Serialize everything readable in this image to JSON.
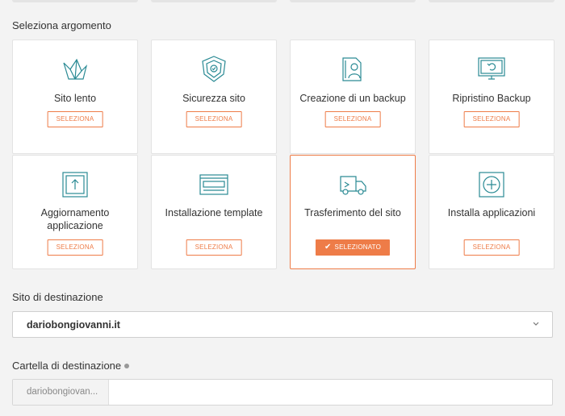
{
  "heading": "Seleziona argomento",
  "cards": [
    {
      "title": "Sito lento",
      "icon": "origami-bird-icon",
      "button": "SELEZIONA",
      "selected": false
    },
    {
      "title": "Sicurezza sito",
      "icon": "shield-icon",
      "button": "SELEZIONA",
      "selected": false
    },
    {
      "title": "Creazione di un backup",
      "icon": "backup-user-icon",
      "button": "SELEZIONA",
      "selected": false
    },
    {
      "title": "Ripristino Backup",
      "icon": "monitor-restore-icon",
      "button": "SELEZIONA",
      "selected": false
    },
    {
      "title": "Aggiornamento applicazione",
      "icon": "upload-arrow-icon",
      "button": "SELEZIONA",
      "selected": false
    },
    {
      "title": "Installazione template",
      "icon": "template-layout-icon",
      "button": "SELEZIONA",
      "selected": false
    },
    {
      "title": "Trasferimento del sito",
      "icon": "delivery-truck-icon",
      "button": "SELEZIONATO",
      "selected": true
    },
    {
      "title": "Installa applicazioni",
      "icon": "plus-box-icon",
      "button": "SELEZIONA",
      "selected": false
    }
  ],
  "destination_site": {
    "label": "Sito di destinazione",
    "value": "dariobongiovanni.it"
  },
  "destination_folder": {
    "label": "Cartella di destinazione",
    "prefix": "dariobongiovan..."
  },
  "colors": {
    "accent": "#ee7c48",
    "icon": "#2a8a94"
  }
}
